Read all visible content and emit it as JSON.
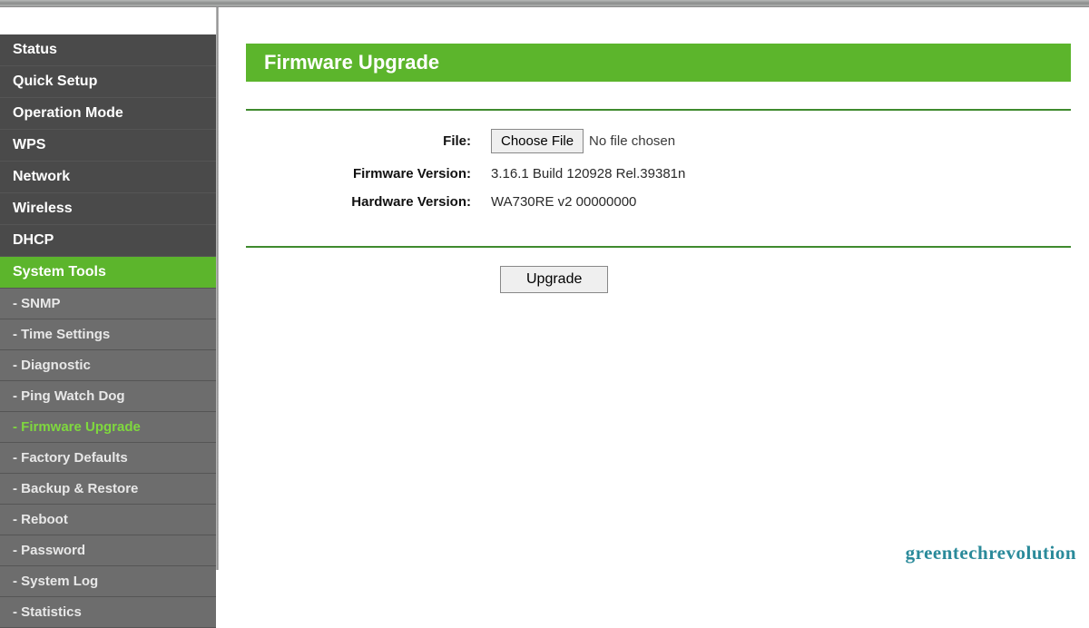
{
  "sidebar": {
    "items": [
      {
        "label": "Status",
        "type": "dark"
      },
      {
        "label": "Quick Setup",
        "type": "dark"
      },
      {
        "label": "Operation Mode",
        "type": "dark"
      },
      {
        "label": "WPS",
        "type": "dark"
      },
      {
        "label": "Network",
        "type": "dark"
      },
      {
        "label": "Wireless",
        "type": "dark"
      },
      {
        "label": "DHCP",
        "type": "dark"
      },
      {
        "label": "System Tools",
        "type": "active-parent"
      },
      {
        "label": "- SNMP",
        "type": "sub"
      },
      {
        "label": "- Time Settings",
        "type": "sub"
      },
      {
        "label": "- Diagnostic",
        "type": "sub"
      },
      {
        "label": "- Ping Watch Dog",
        "type": "sub"
      },
      {
        "label": "- Firmware Upgrade",
        "type": "sub active"
      },
      {
        "label": "- Factory Defaults",
        "type": "sub"
      },
      {
        "label": "- Backup & Restore",
        "type": "sub"
      },
      {
        "label": "- Reboot",
        "type": "sub"
      },
      {
        "label": "- Password",
        "type": "sub"
      },
      {
        "label": "- System Log",
        "type": "sub"
      },
      {
        "label": "- Statistics",
        "type": "sub"
      }
    ]
  },
  "page": {
    "title": "Firmware Upgrade"
  },
  "form": {
    "file_label": "File:",
    "choose_file_button": "Choose File",
    "no_file_text": "No file chosen",
    "firmware_label": "Firmware Version:",
    "firmware_value": "3.16.1 Build 120928 Rel.39381n",
    "hardware_label": "Hardware Version:",
    "hardware_value": "WA730RE v2 00000000",
    "upgrade_button": "Upgrade"
  },
  "watermark": "greentechrevolution"
}
